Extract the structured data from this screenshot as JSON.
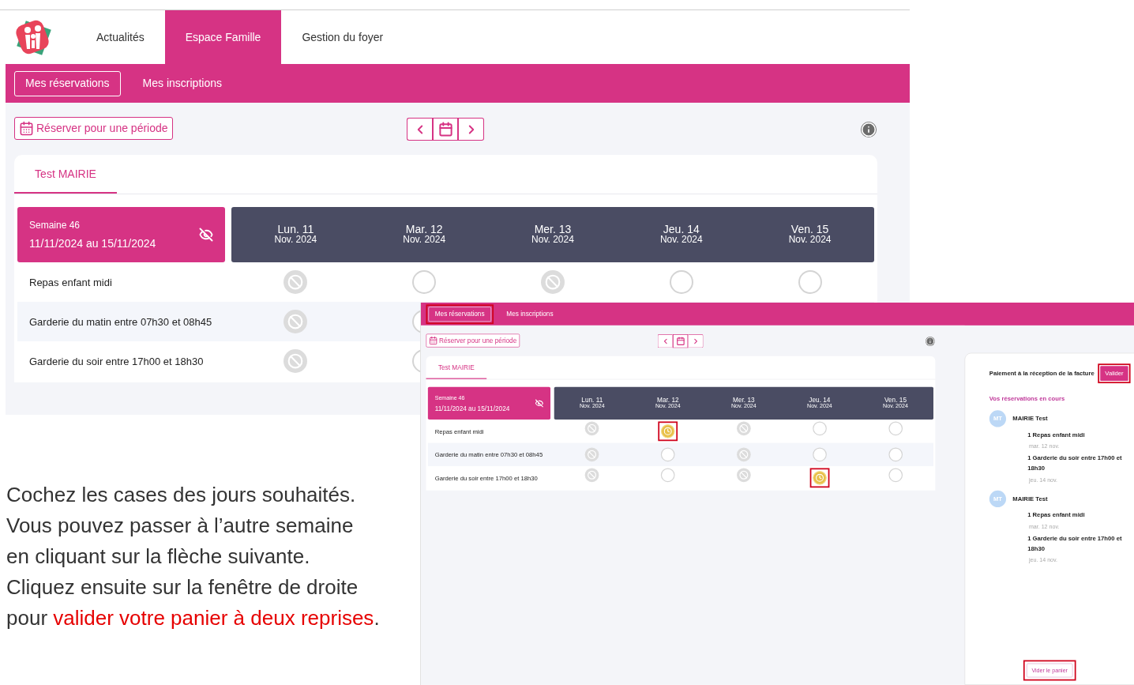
{
  "guide_screen": {
    "nav_tabs": [
      {
        "label": "Actualités",
        "selected": false
      },
      {
        "label": "Espace Famille",
        "selected": true
      },
      {
        "label": "Gestion du foyer",
        "selected": false
      }
    ],
    "sub_tabs": [
      {
        "label": "Mes réservations",
        "selected": true
      },
      {
        "label": "Mes inscriptions",
        "selected": false
      }
    ],
    "period_button": "Réserver pour une période",
    "child_tab": {
      "label": "Test MAIRIE",
      "selected": true
    },
    "week": {
      "label": "Semaine 46",
      "range": "11/11/2024 au 15/11/2024"
    },
    "days": [
      {
        "day": "Lun. 11",
        "month": "Nov. 2024"
      },
      {
        "day": "Mar. 12",
        "month": "Nov. 2024"
      },
      {
        "day": "Mer. 13",
        "month": "Nov. 2024"
      },
      {
        "day": "Jeu. 14",
        "month": "Nov. 2024"
      },
      {
        "day": "Ven. 15",
        "month": "Nov. 2024"
      }
    ],
    "rows": [
      {
        "label": "Repas enfant midi",
        "cells": [
          {
            "kind": "blocked"
          },
          {
            "kind": "empty"
          },
          {
            "kind": "blocked"
          },
          {
            "kind": "empty"
          },
          {
            "kind": "empty"
          }
        ]
      },
      {
        "label": "Garderie du matin entre 07h30 et 08h45",
        "cells": [
          {
            "kind": "blocked"
          },
          {
            "kind": "empty"
          }
        ]
      },
      {
        "label": "Garderie du soir entre 17h00 et 18h30",
        "cells": [
          {
            "kind": "blocked"
          },
          {
            "kind": "empty"
          }
        ]
      }
    ]
  },
  "caption": {
    "lines": [
      "Cochez les cases des jours souhaités.",
      "Vous pouvez passer à l’autre semaine",
      "en cliquant sur la flèche suivante.",
      "Cliquez ensuite sur la fenêtre de droite",
      "pour "
    ],
    "emphasis": "valider votre panier à deux reprises",
    "end": "."
  },
  "detail_screen": {
    "sub_tabs": [
      {
        "label": "Mes réservations",
        "selected": true,
        "highlighted": true
      },
      {
        "label": "Mes inscriptions",
        "selected": false,
        "highlighted": false
      }
    ],
    "period_button": "Réserver pour une période",
    "child_tab": {
      "label": "Test MAIRIE",
      "selected": true
    },
    "week": {
      "label": "Semaine 46",
      "range": "11/11/2024 au 15/11/2024"
    },
    "days": [
      {
        "day": "Lun. 11",
        "month": "Nov. 2024"
      },
      {
        "day": "Mar. 12",
        "month": "Nov. 2024"
      },
      {
        "day": "Mer. 13",
        "month": "Nov. 2024"
      },
      {
        "day": "Jeu. 14",
        "month": "Nov. 2024"
      },
      {
        "day": "Ven. 15",
        "month": "Nov. 2024"
      }
    ],
    "rows": [
      {
        "label": "Repas enfant midi",
        "cells": [
          {
            "kind": "blocked",
            "highlighted": false
          },
          {
            "kind": "pending",
            "highlighted": true
          },
          {
            "kind": "blocked",
            "highlighted": false
          },
          {
            "kind": "empty",
            "highlighted": false
          },
          {
            "kind": "empty",
            "highlighted": false
          }
        ]
      },
      {
        "label": "Garderie du matin entre 07h30 et 08h45",
        "cells": [
          {
            "kind": "blocked",
            "highlighted": false
          },
          {
            "kind": "empty",
            "highlighted": false
          },
          {
            "kind": "blocked",
            "highlighted": false
          },
          {
            "kind": "empty",
            "highlighted": false
          },
          {
            "kind": "empty",
            "highlighted": false
          }
        ]
      },
      {
        "label": "Garderie du soir entre 17h00 et 18h30",
        "cells": [
          {
            "kind": "blocked",
            "highlighted": false
          },
          {
            "kind": "empty",
            "highlighted": false
          },
          {
            "kind": "blocked",
            "highlighted": false
          },
          {
            "kind": "pending",
            "highlighted": true
          },
          {
            "kind": "empty",
            "highlighted": false
          }
        ]
      }
    ],
    "basket": {
      "title": "Paiement à la réception de la facture",
      "validate": {
        "label": "Valider",
        "highlighted": true
      },
      "section": "Vos réservations en cours",
      "groups": [
        {
          "initials": "MT",
          "name": "MAIRIE Test",
          "items": [
            {
              "label": "1 Repas enfant midi",
              "date": "mar. 12 nov."
            },
            {
              "label": "1 Garderie du soir entre 17h00 et 18h30",
              "date": "jeu. 14 nov."
            }
          ]
        },
        {
          "initials": "MT",
          "name": "MAIRIE Test",
          "items": [
            {
              "label": "1 Repas enfant midi",
              "date": "mar. 12 nov."
            },
            {
              "label": "1 Garderie du soir entre 17h00 et 18h30",
              "date": "jeu. 14 nov."
            }
          ]
        }
      ],
      "clear": {
        "label": "Vider le panier",
        "highlighted": true
      }
    }
  }
}
